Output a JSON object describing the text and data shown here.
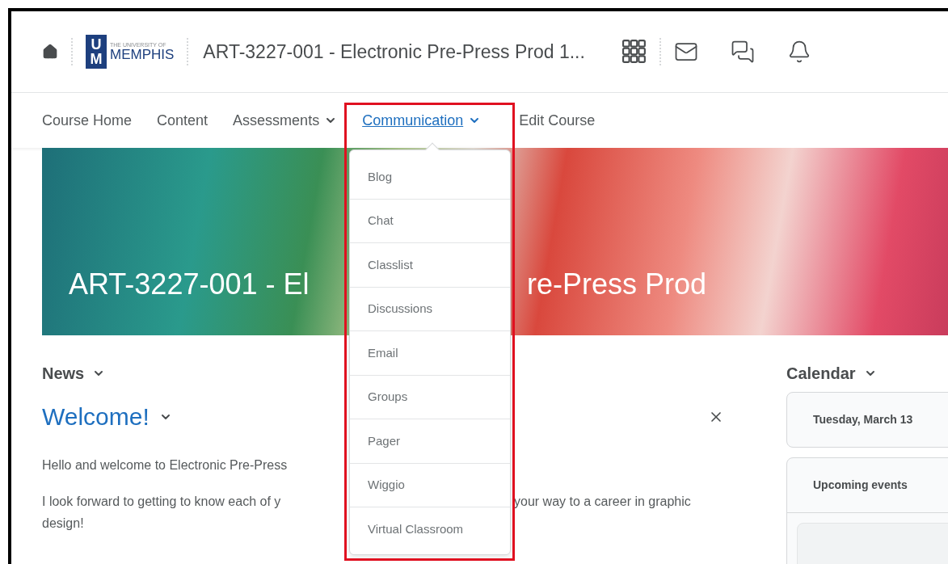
{
  "header": {
    "logo": {
      "monogram": [
        "U",
        "M"
      ],
      "small": "THE UNIVERSITY OF",
      "big": "MEMPHIS"
    },
    "course_title": "ART-3227-001 - Electronic Pre-Press Prod 1..."
  },
  "nav": [
    {
      "label": "Course Home",
      "dropdown": false,
      "selected": false
    },
    {
      "label": "Content",
      "dropdown": false,
      "selected": false
    },
    {
      "label": "Assessments",
      "dropdown": true,
      "selected": false
    },
    {
      "label": "Communication",
      "dropdown": true,
      "selected": true
    },
    {
      "label": "Edit Course",
      "dropdown": false,
      "selected": false
    }
  ],
  "menu": {
    "items": [
      "Blog",
      "Chat",
      "Classlist",
      "Discussions",
      "Email",
      "Groups",
      "Pager",
      "Wiggio",
      "Virtual Classroom"
    ]
  },
  "banner": {
    "title_left": "ART-3227-001 - El",
    "title_right": "re-Press Prod"
  },
  "news": {
    "heading": "News",
    "post": {
      "title": "Welcome!",
      "paragraphs": [
        {
          "lines": [
            {
              "left": "Hello and welcome to Electronic Pre-Press"
            }
          ]
        },
        {
          "lines": [
            {
              "left": "I look forward to getting to know each of y",
              "right": "your way to a career in graphic"
            },
            {
              "left": "design!"
            }
          ]
        }
      ]
    }
  },
  "calendar": {
    "heading": "Calendar",
    "date": "Tuesday, March 13",
    "upcoming": "Upcoming events"
  }
}
